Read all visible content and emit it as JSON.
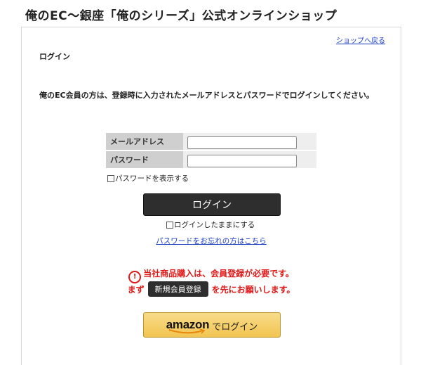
{
  "site": {
    "title": "俺のEC〜銀座「俺のシリーズ」公式オンラインショップ"
  },
  "nav": {
    "back_link": "ショップへ戻る"
  },
  "page": {
    "heading": "ログイン",
    "intro": "俺のEC会員の方は、登録時に入力されたメールアドレスとパスワードでログインしてください。"
  },
  "form": {
    "email_label": "メールアドレス",
    "email_value": "",
    "password_label": "パスワード",
    "password_value": "",
    "show_password_label": "パスワードを表示する",
    "show_password_checked": false,
    "login_button": "ログイン",
    "keep_login_label": "ログインしたままにする",
    "keep_login_checked": false,
    "forgot_link": "パスワードをお忘れの方はこちら"
  },
  "notice": {
    "line1": "当社商品購入は、会員登録が必要です。",
    "prefix": "まず",
    "register_button": "新規会員登録",
    "suffix": "を先にお願いします。",
    "color": "#e01818"
  },
  "amazon": {
    "logo_text": "amazon",
    "button_text": "でログイン",
    "color": "#f2c451"
  }
}
